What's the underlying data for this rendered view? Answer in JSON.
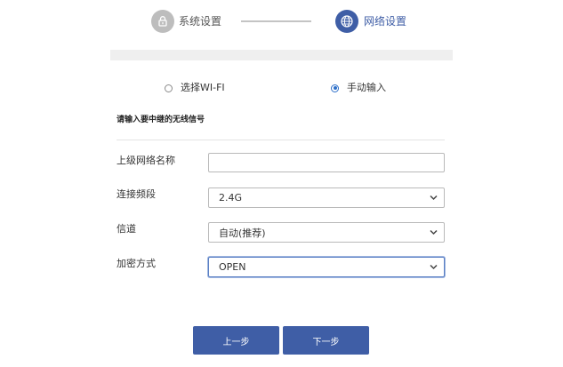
{
  "stepper": {
    "steps": [
      {
        "label": "系统设置",
        "icon": "lock-icon",
        "state": "done"
      },
      {
        "label": "网络设置",
        "icon": "globe-icon",
        "state": "active"
      }
    ]
  },
  "mode": {
    "options": [
      {
        "label": "选择WI-FI",
        "checked": false
      },
      {
        "label": "手动输入",
        "checked": true
      }
    ]
  },
  "section_title": "请输入要中继的无线信号",
  "form": {
    "ssid": {
      "label": "上级网络名称",
      "value": ""
    },
    "band": {
      "label": "连接频段",
      "value": "2.4G"
    },
    "channel": {
      "label": "信道",
      "value": "自动(推荐)"
    },
    "encryption": {
      "label": "加密方式",
      "value": "OPEN"
    }
  },
  "buttons": {
    "prev": "上一步",
    "next": "下一步"
  },
  "colors": {
    "accent": "#3f5ea6",
    "radio_checked": "#2d6fc9",
    "step_done": "#bdbdbd",
    "border": "#b9b9b9"
  }
}
